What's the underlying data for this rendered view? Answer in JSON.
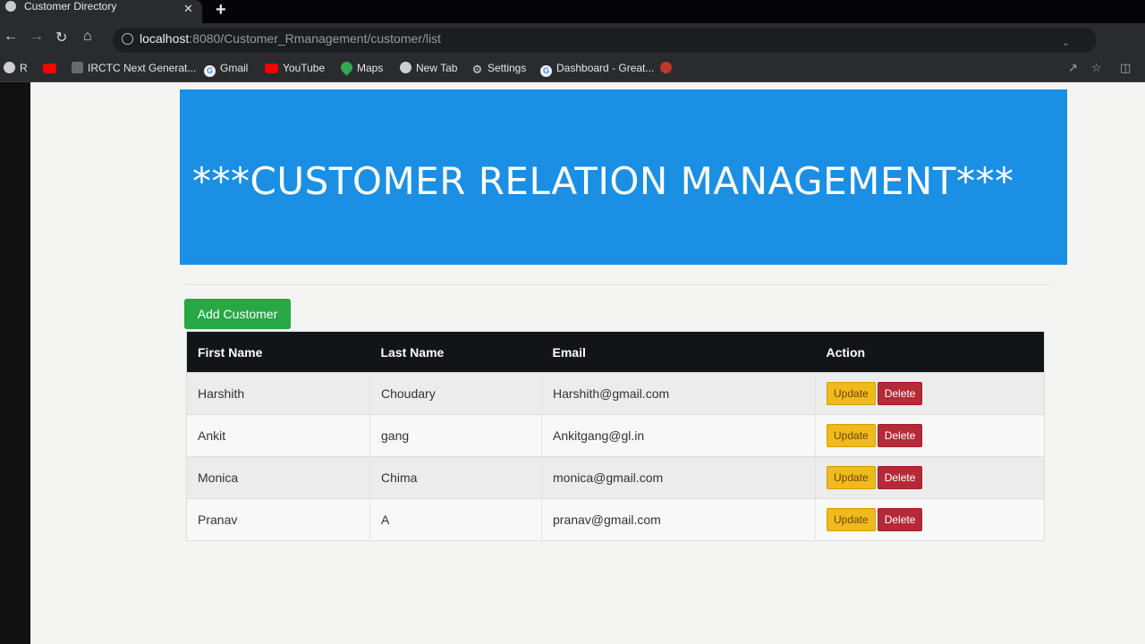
{
  "browser": {
    "tab_title": "Customer Directory",
    "tab_close": "✕",
    "new_tab": "+",
    "url_host": "localhost",
    "url_path": ":8080/Customer_Rmanagement/customer/list",
    "bookmarks": [
      {
        "label": "R",
        "icon": "globe-icon"
      },
      {
        "label": "",
        "icon": "youtube-icon"
      },
      {
        "label": "IRCTC Next Generat...",
        "icon": "irctc-icon"
      },
      {
        "label": "Gmail",
        "icon": "google-icon"
      },
      {
        "label": "YouTube",
        "icon": "youtube-icon"
      },
      {
        "label": "Maps",
        "icon": "maps-icon"
      },
      {
        "label": "New Tab",
        "icon": "globe-icon"
      },
      {
        "label": "Settings",
        "icon": "gear-icon"
      },
      {
        "label": "Dashboard - Great...",
        "icon": "google-icon"
      }
    ]
  },
  "page": {
    "banner_title": "***CUSTOMER RELATION MANAGEMENT***",
    "add_button": "Add Customer",
    "table": {
      "headers": [
        "First Name",
        "Last Name",
        "Email",
        "Action"
      ],
      "rows": [
        {
          "first": "Harshith",
          "last": "Choudary",
          "email": "Harshith@gmail.com"
        },
        {
          "first": "Ankit",
          "last": "gang",
          "email": "Ankitgang@gl.in"
        },
        {
          "first": "Monica",
          "last": "Chima",
          "email": "monica@gmail.com"
        },
        {
          "first": "Pranav",
          "last": "A",
          "email": "pranav@gmail.com"
        }
      ],
      "update_label": "Update",
      "delete_label": "Delete"
    }
  },
  "colors": {
    "banner": "#1a8fe3",
    "add_button": "#28a745",
    "update_button": "#f0b91c",
    "delete_button": "#b52a37",
    "table_header": "#121417"
  }
}
